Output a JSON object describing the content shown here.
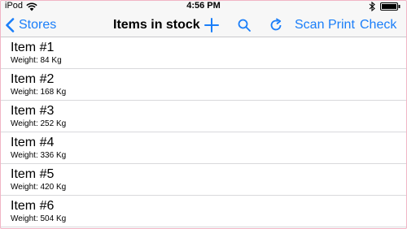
{
  "status_bar": {
    "carrier": "iPod",
    "time": "4:56 PM",
    "battery_level": 1.0,
    "icons": [
      "wifi-icon",
      "bluetooth-icon",
      "battery-icon"
    ]
  },
  "nav_bar": {
    "back_label": "Stores",
    "title": "Items in stock",
    "icons": [
      "add-icon",
      "search-icon",
      "refresh-icon"
    ],
    "scan_label": "Scan",
    "print_label": "Print",
    "check_label": "Check"
  },
  "colors": {
    "accent": "#1a7ef9",
    "bar_background": "#f7f7f7",
    "separator": "#d9d9dc"
  },
  "items": [
    {
      "title": "Item #1",
      "subtitle": "Weight: 84 Kg"
    },
    {
      "title": "Item #2",
      "subtitle": "Weight: 168 Kg"
    },
    {
      "title": "Item #3",
      "subtitle": "Weight: 252 Kg"
    },
    {
      "title": "Item #4",
      "subtitle": "Weight: 336 Kg"
    },
    {
      "title": "Item #5",
      "subtitle": "Weight: 420 Kg"
    },
    {
      "title": "Item #6",
      "subtitle": "Weight: 504 Kg"
    }
  ]
}
